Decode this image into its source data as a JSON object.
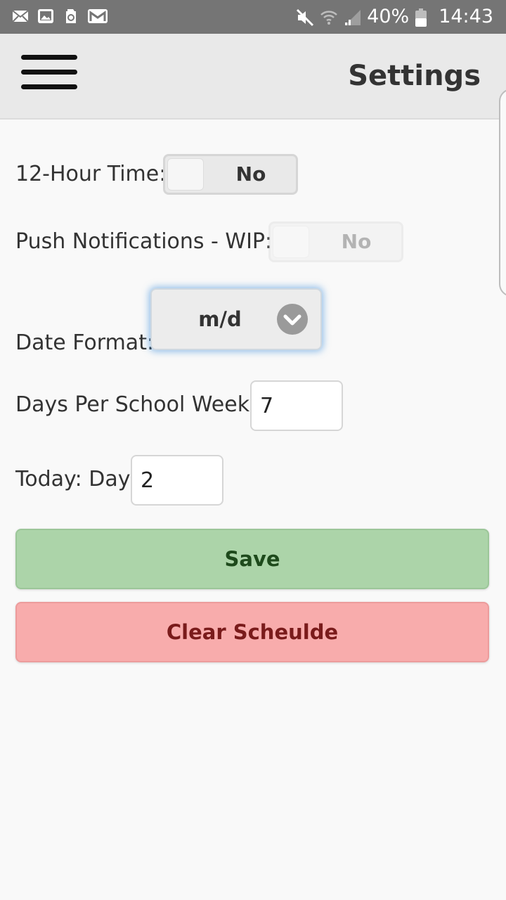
{
  "status_bar": {
    "left_icons": [
      "mail-icon",
      "image-icon",
      "recycle-icon",
      "gmail-icon"
    ],
    "right_icons": [
      "mute-icon",
      "wifi-icon",
      "signal-icon"
    ],
    "battery_text": "40%",
    "time": "14:43"
  },
  "header": {
    "menu_icon": "hamburger-menu-icon",
    "title": "Settings"
  },
  "settings": {
    "twelve_hour": {
      "label": "12-Hour Time:",
      "value": "No"
    },
    "push_notifications": {
      "label": "Push Notifications - WIP:",
      "value": "No",
      "enabled": false
    },
    "date_format": {
      "label": "Date Format:",
      "value": "m/d",
      "icon": "chevron-down-icon"
    },
    "days_per_week": {
      "label": "Days Per School Week:",
      "value": "7"
    },
    "today_day": {
      "label": "Today: Day",
      "value": "2"
    }
  },
  "buttons": {
    "save": "Save",
    "clear": "Clear Scheulde"
  },
  "colors": {
    "status_bar": "#757575",
    "header_bg": "#e9e9e9",
    "save_bg": "#acd4a9",
    "clear_bg": "#f8acac",
    "select_focus": "#388cdc"
  }
}
